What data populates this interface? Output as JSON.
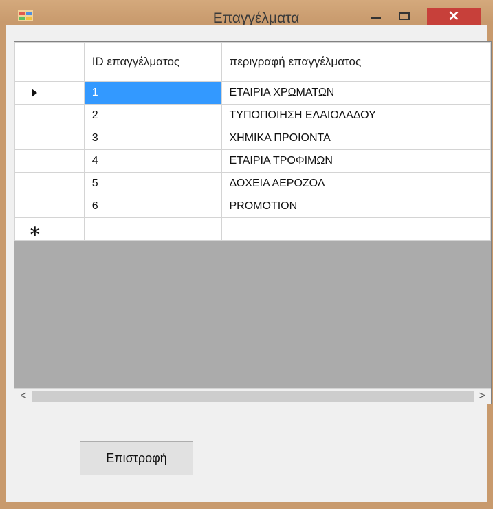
{
  "window": {
    "title": "Επαγγέλματα",
    "close_glyph": "✕",
    "icon": "app-form-icon"
  },
  "grid": {
    "columns": [
      "ID επαγγέλματος",
      "περιγραφή επαγγέλματος"
    ],
    "rows": [
      {
        "id": "1",
        "description": "ΕΤΑΙΡΙΑ ΧΡΩΜΑΤΩΝ",
        "selected": true
      },
      {
        "id": "2",
        "description": "ΤΥΠΟΠΟΙΗΣΗ ΕΛΑΙΟΛΑΔΟΥ"
      },
      {
        "id": "3",
        "description": "ΧΗΜΙΚΑ ΠΡΟΙΟΝΤΑ"
      },
      {
        "id": "4",
        "description": "ΕΤΑΙΡΙΑ ΤΡΟΦΙΜΩΝ"
      },
      {
        "id": "5",
        "description": "ΔΟΧΕΙΑ ΑΕΡΟΖΟΛ"
      },
      {
        "id": "6",
        "description": "PROMOTION"
      }
    ],
    "new_row_glyph": "∗",
    "scroll_left_glyph": "<",
    "scroll_right_glyph": ">"
  },
  "buttons": {
    "back_label": "Επιστροφή"
  },
  "colors": {
    "selection": "#3399ff",
    "close": "#c7403a",
    "grid_background": "#ababab"
  }
}
